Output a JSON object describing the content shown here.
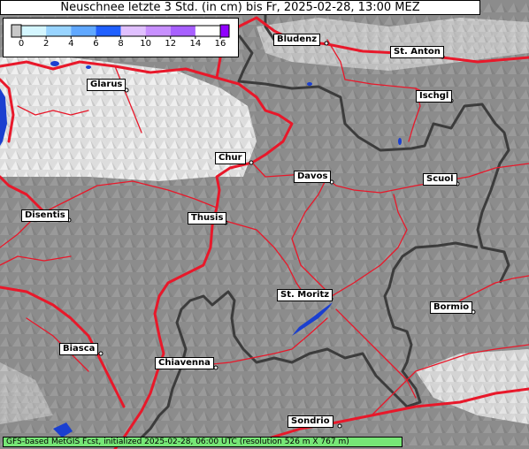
{
  "title": "Neuschnee letzte 3 Std. (in cm) bis Fr, 2025-02-28, 13:00 MEZ",
  "legend": {
    "ticks": [
      "0",
      "2",
      "4",
      "6",
      "8",
      "10",
      "12",
      "14",
      "16"
    ],
    "colors": [
      "#c8c8c8",
      "#d4f6ff",
      "#98d4ff",
      "#60a8ff",
      "#2060ff",
      "#e0c0ff",
      "#c890ff",
      "#a860ff",
      "#9000ff"
    ]
  },
  "places": [
    {
      "id": "bludenz",
      "name": "Bludenz"
    },
    {
      "id": "st-anton",
      "name": "St. Anton"
    },
    {
      "id": "glarus",
      "name": "Glarus"
    },
    {
      "id": "ischgl",
      "name": "Ischgl"
    },
    {
      "id": "chur",
      "name": "Chur"
    },
    {
      "id": "davos",
      "name": "Davos"
    },
    {
      "id": "scuol",
      "name": "Scuol"
    },
    {
      "id": "disentis",
      "name": "Disentis"
    },
    {
      "id": "thusis",
      "name": "Thusis"
    },
    {
      "id": "st-moritz",
      "name": "St. Moritz"
    },
    {
      "id": "bormio",
      "name": "Bormio"
    },
    {
      "id": "biasca",
      "name": "Biasca"
    },
    {
      "id": "chiavenna",
      "name": "Chiavenna"
    },
    {
      "id": "sondrio",
      "name": "Sondrio"
    }
  ],
  "footer": "GFS-based MetGIS Fcst, initialized 2025-02-28, 06:00 UTC  (resolution 526 m X 767 m)"
}
